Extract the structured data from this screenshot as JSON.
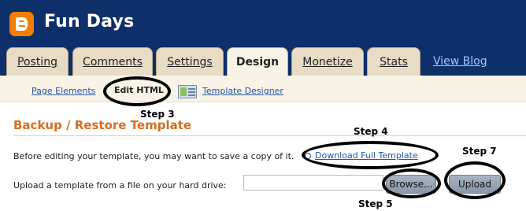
{
  "header": {
    "title": "Fun Days"
  },
  "tabs": [
    {
      "label": "Posting"
    },
    {
      "label": "Comments"
    },
    {
      "label": "Settings"
    },
    {
      "label": "Design"
    },
    {
      "label": "Monetize"
    },
    {
      "label": "Stats"
    }
  ],
  "view_blog": "View Blog",
  "subnav": {
    "page_elements": "Page Elements",
    "edit_html": "Edit HTML",
    "template_designer": "Template Designer"
  },
  "annotations": {
    "step3": "Step 3",
    "step4": "Step 4",
    "step5": "Step 5",
    "step7": "Step 7"
  },
  "section": {
    "title": "Backup / Restore Template",
    "backup_text": "Before editing your template, you may want to save a copy of it.",
    "download_label": "Download Full Template",
    "upload_text": "Upload a template from a file on your hard drive:",
    "browse_label": "Browse...",
    "upload_label": "Upload"
  },
  "colors": {
    "header_bg": "#0d2f6a",
    "tab_bg": "#e8dcc5",
    "active_tab_bg": "#f8f3e7",
    "section_title": "#d86d1e",
    "link": "#2255aa",
    "logo": "#f57d00"
  },
  "icons": [
    "blogger-logo-icon",
    "template-designer-icon",
    "download-icon"
  ]
}
